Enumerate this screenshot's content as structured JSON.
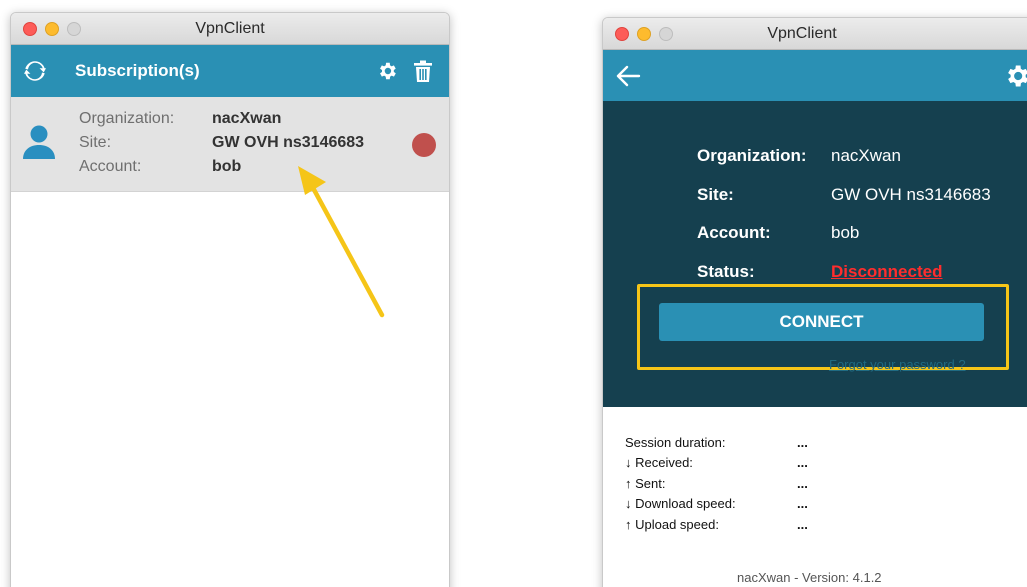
{
  "left_window": {
    "title": "VpnClient",
    "toolbar": {
      "title": "Subscription(s)",
      "icons": [
        "refresh-icon",
        "gear-icon",
        "trash-icon"
      ]
    },
    "subscription": {
      "organization_label": "Organization:",
      "organization_value": "nacXwan",
      "site_label": "Site:",
      "site_value": "GW OVH ns3146683",
      "account_label": "Account:",
      "account_value": "bob",
      "status_color": "#c0504d"
    }
  },
  "right_window": {
    "title": "VpnClient",
    "toolbar": {
      "icons": [
        "back-arrow-icon",
        "gear-icon"
      ]
    },
    "info": {
      "organization_label": "Organization:",
      "organization_value": "nacXwan",
      "site_label": "Site:",
      "site_value": "GW OVH ns3146683",
      "account_label": "Account:",
      "account_value": "bob",
      "status_label": "Status:",
      "status_value": "Disconnected"
    },
    "connect_label": "CONNECT",
    "forgot_label": "Forgot your password ?",
    "stats": [
      {
        "label": "Session duration:",
        "value": "..."
      },
      {
        "label": "↓ Received:",
        "value": "..."
      },
      {
        "label": "↑ Sent:",
        "value": "..."
      },
      {
        "label": "↓ Download speed:",
        "value": "..."
      },
      {
        "label": "↑ Upload speed:",
        "value": "..."
      }
    ],
    "version": "nacXwan - Version: 4.1.2"
  },
  "colors": {
    "accent": "#2a90b4",
    "dark_panel": "#15404f",
    "disconnected": "#ff2d2d",
    "annotation": "#f5c518"
  }
}
